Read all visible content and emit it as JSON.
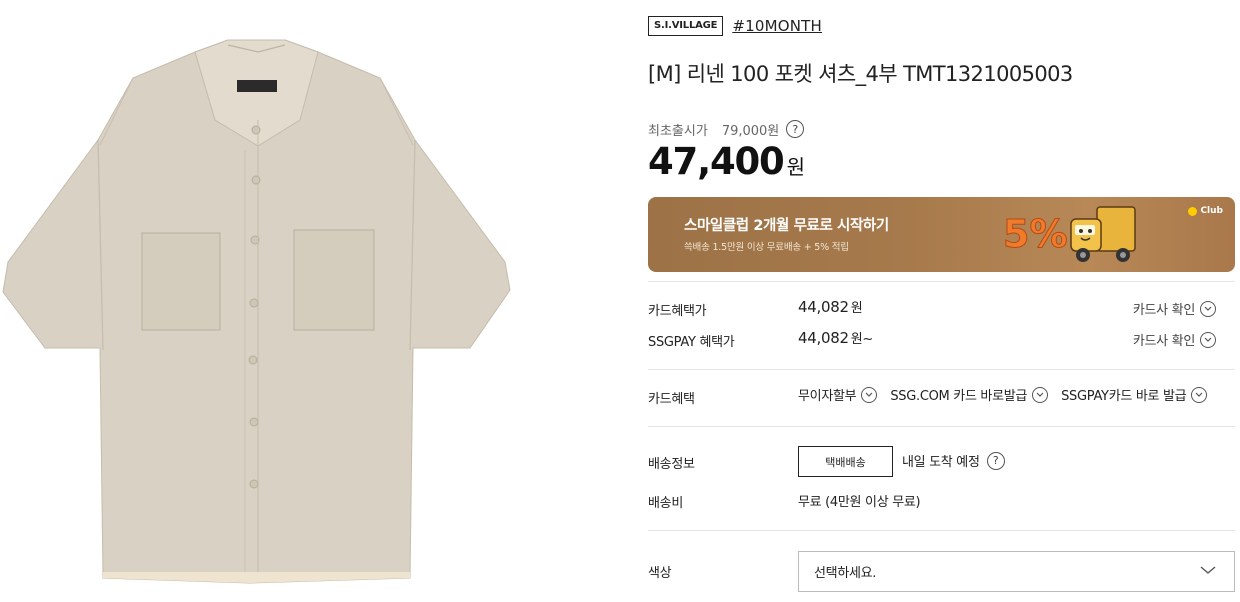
{
  "product_image": {
    "label_text": "10MONTH",
    "alt": "shirt-image"
  },
  "brand": {
    "badge": "S.I.VILLAGE",
    "tag": "#10MONTH"
  },
  "title": "[M] 리넨 100 포켓 셔츠_4부 TMT1321005003",
  "original_price": {
    "label": "최초출시가",
    "value": "79,000원",
    "help": "?"
  },
  "price": {
    "value": "47,400",
    "currency": "원"
  },
  "banner": {
    "title": "스마일클럽 2개월 무료로 시작하기",
    "subtitle": "쓱배송 1.5만원 이상 무료배송 + 5% 적립",
    "club": "Club",
    "percent": "5%"
  },
  "card_price": {
    "label": "카드혜택가",
    "value": "44,082",
    "unit": "원",
    "check": "카드사 확인"
  },
  "ssgpay_price": {
    "label": "SSGPAY 혜택가",
    "value": "44,082",
    "unit": "원~",
    "check": "카드사 확인"
  },
  "card_benefit": {
    "label": "카드혜택",
    "links": [
      "무이자할부",
      "SSG.COM 카드 바로발급",
      "SSGPAY카드 바로 발급"
    ]
  },
  "delivery": {
    "label": "배송정보",
    "method": "택배배송",
    "eta": "내일 도착 예정",
    "help": "?"
  },
  "shipping_fee": {
    "label": "배송비",
    "value": "무료 (4만원 이상 무료)"
  },
  "color": {
    "label": "색상",
    "placeholder": "선택하세요."
  },
  "colors": {
    "shirt": "#d9d1c3",
    "banner": "#a77a4c",
    "accent_orange": "#f07b2b",
    "club_yellow": "#ffcc00"
  }
}
